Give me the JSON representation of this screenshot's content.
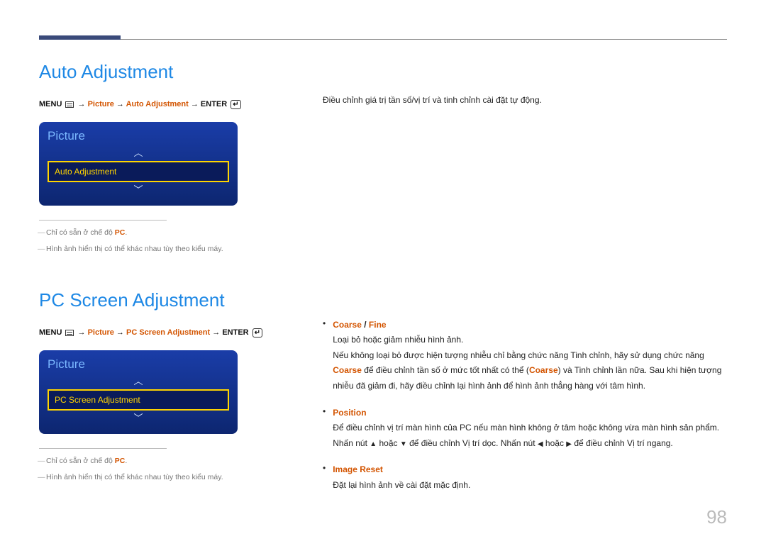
{
  "section1": {
    "title": "Auto Adjustment",
    "path_menu": "MENU",
    "path_picture": "Picture",
    "path_item": "Auto Adjustment",
    "path_enter": "ENTER",
    "osd_title": "Picture",
    "osd_selected": "Auto Adjustment",
    "note1_prefix": "Chỉ có sẵn ở chế độ ",
    "note1_pc": "PC",
    "note2": "Hình ảnh hiển thị có thể khác nhau tùy theo kiểu máy.",
    "desc": "Điều chỉnh giá trị tần số/vị trí và tinh chỉnh cài đặt tự động."
  },
  "section2": {
    "title": "PC Screen Adjustment",
    "path_menu": "MENU",
    "path_picture": "Picture",
    "path_item": "PC Screen Adjustment",
    "path_enter": "ENTER",
    "osd_title": "Picture",
    "osd_selected": "PC Screen Adjustment",
    "note1_prefix": "Chỉ có sẵn ở chế độ ",
    "note1_pc": "PC",
    "note2": "Hình ảnh hiển thị có thể khác nhau tùy theo kiểu máy.",
    "bullets": {
      "coarse_label": "Coarse",
      "fine_label": "Fine",
      "coarse_sep": " / ",
      "coarse_body1": "Loại bỏ hoặc giảm nhiễu hình ảnh.",
      "coarse_body2a": "Nếu không loại bỏ được hiện tượng nhiễu chỉ bằng chức năng Tinh chỉnh, hãy sử dụng chức năng ",
      "coarse_body2b": " để điều chỉnh tần số ở mức tốt nhất có thể (",
      "coarse_body2c": ") và Tinh chỉnh lần nữa. Sau khi hiện tượng nhiễu đã giảm đi, hãy điều chỉnh lại hình ảnh để hình ảnh thẳng hàng với tâm hình.",
      "position_label": "Position",
      "position_body1": "Để điều chỉnh vị trí màn hình của PC nếu màn hình không ở tâm hoặc không vừa màn hình sản phẩm.",
      "position_body2a": "Nhấn nút ",
      "position_body2b": " hoặc ",
      "position_body2c": " để điều chỉnh Vị trí dọc. Nhấn nút ",
      "position_body2d": " hoặc ",
      "position_body2e": " để điều chỉnh Vị trí ngang.",
      "imagereset_label": "Image Reset",
      "imagereset_body": "Đặt lại hình ảnh về cài đặt mặc định."
    }
  },
  "pageNumber": "98",
  "arrows": {
    "up": "▲",
    "down": "▼",
    "left": "◀",
    "right": "▶"
  }
}
